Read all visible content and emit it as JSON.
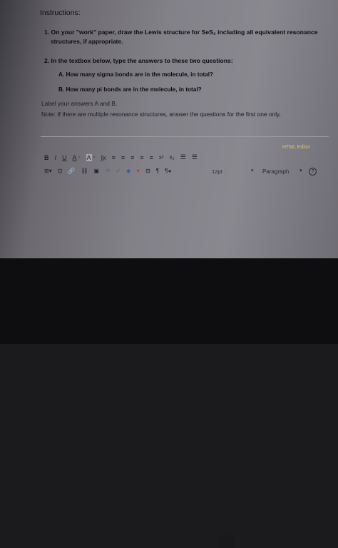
{
  "instructions": {
    "title": "Instructions:",
    "item1_line1": "1. On your \"work\" paper, draw the Lewis structure for SeS₂ including all equivalent resonance",
    "item1_line2": "structures, if appropriate.",
    "item2": "2. In the textbox below, type the answers to these two questions:",
    "question_a": "A.  How many sigma bonds are in the molecule, in total?",
    "question_b": "B.  How many pi bonds are in the molecule, in total?",
    "label_hint": "Label your answers A and B.",
    "note": "Note:  If there are multiple resonance structures, answer the questions for the first one only."
  },
  "editor": {
    "html_editor_label": "HTML Editor",
    "toolbar_row1": [
      "B",
      "I",
      "U",
      "A",
      "▾",
      "A",
      "▾",
      "I̲x",
      "≡",
      "≡",
      "≡",
      "≡",
      "≡",
      "x²",
      "x₂",
      "☰",
      "☰"
    ],
    "toolbar_row2": [
      "⊞▾",
      "⊡",
      "🔗",
      "⛓",
      "▣",
      "√x",
      "✓",
      "◆",
      "♥",
      "⊟",
      "¶",
      "¶◂"
    ],
    "font_size": "12pt",
    "paragraph_format": "Paragraph",
    "dropdown_caret": "▾",
    "info_glyph": "?"
  }
}
